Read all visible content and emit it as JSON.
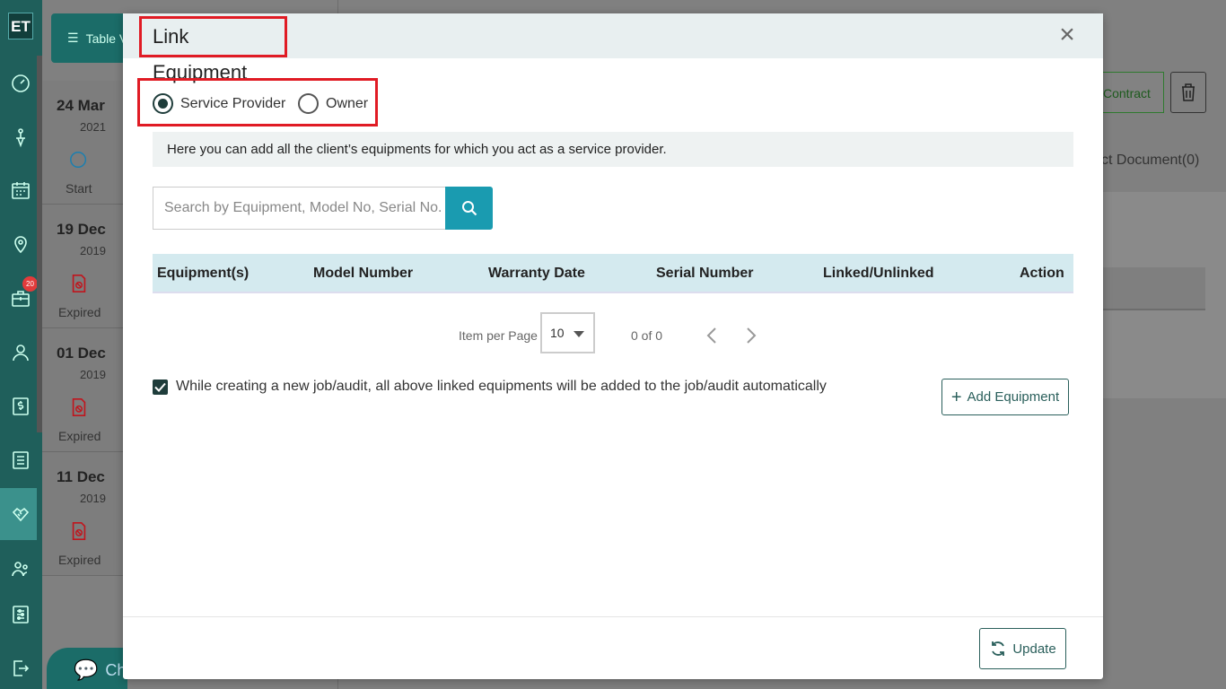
{
  "sidebar": {
    "logo": "ET",
    "notification_count": "20"
  },
  "background": {
    "table_view_label": "Table V",
    "chat_label": "Ch",
    "contract_label": "Contract",
    "document_label": "ct Document(0)",
    "items": [
      {
        "date": "24 Mar",
        "year": "2021",
        "status": "Start"
      },
      {
        "date": "19 Dec",
        "year": "2019",
        "status": "Expired"
      },
      {
        "date": "01 Dec",
        "year": "2019",
        "status": "Expired"
      },
      {
        "date": "11 Dec",
        "year": "2019",
        "status": "Expired"
      }
    ]
  },
  "modal": {
    "title": "Link Equipment",
    "close_symbol": "×",
    "radio_options": [
      {
        "label": "Service Provider",
        "selected": true
      },
      {
        "label": "Owner",
        "selected": false
      }
    ],
    "info_text": "Here you can add all the client’s equipments for which you act as a service provider.",
    "search": {
      "placeholder": "Search by Equipment, Model No, Serial No.",
      "value": ""
    },
    "table": {
      "columns": [
        "Equipment(s)",
        "Model Number",
        "Warranty Date",
        "Serial Number",
        "Linked/Unlinked",
        "Action"
      ]
    },
    "pagination": {
      "items_per_page_label": "Item per Page",
      "items_per_page_value": "10",
      "page_count": "0 of 0"
    },
    "auto_add_checkbox": {
      "label": "While creating a new job/audit, all above linked equipments will be added to the job/audit automatically",
      "checked": true
    },
    "add_equipment_label": "Add Equipment",
    "update_label": "Update"
  },
  "colors": {
    "sidebar": "#1f5f5b",
    "accent_teal": "#1a9bb0",
    "highlight_red": "#e01b24",
    "table_header": "#d4eaef"
  }
}
